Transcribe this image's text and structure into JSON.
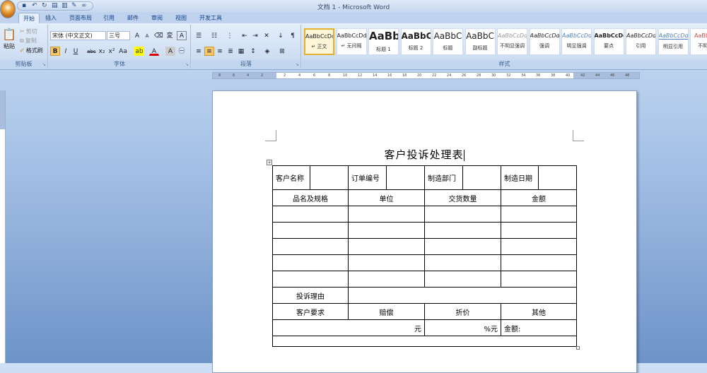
{
  "window": {
    "title": "文档 1 - Microsoft Word"
  },
  "tabs": [
    "开始",
    "插入",
    "页面布局",
    "引用",
    "邮件",
    "审阅",
    "视图",
    "开发工具"
  ],
  "clipboard": {
    "paste": "粘贴",
    "cut": "剪切",
    "copy": "复制",
    "format_painter": "格式刷",
    "label": "剪贴板"
  },
  "font": {
    "name": "宋体 (中文正文)",
    "size": "三号",
    "label": "字体",
    "bold": "B",
    "italic": "I",
    "underline": "U",
    "strike": "abc",
    "sub": "x₂",
    "sup": "x²",
    "case": "Aa",
    "grow": "A",
    "shrink": "A",
    "color": "A",
    "charshade": "A",
    "enclose": "㊀"
  },
  "paragraph": {
    "label": "段落"
  },
  "styles": {
    "label": "样式",
    "items": [
      {
        "sample": "AaBbCcDd",
        "name": "↵ 正文"
      },
      {
        "sample": "AaBbCcDd",
        "name": "↵ 无间隔"
      },
      {
        "sample": "AaBb",
        "name": "标题 1"
      },
      {
        "sample": "AaBbC",
        "name": "标题 2"
      },
      {
        "sample": "AaBbC",
        "name": "标题"
      },
      {
        "sample": "AaBbC",
        "name": "副标题"
      },
      {
        "sample": "AaBbCcDd",
        "name": "不明显强调"
      },
      {
        "sample": "AaBbCcDd",
        "name": "强调"
      },
      {
        "sample": "AaBbCcDd",
        "name": "明显强调"
      },
      {
        "sample": "AaBbCcDd",
        "name": "要点"
      },
      {
        "sample": "AaBbCcDd",
        "name": "引用"
      },
      {
        "sample": "AaBbCcDd",
        "name": "明显引用"
      },
      {
        "sample": "AaBbCc",
        "name": "不明显"
      }
    ]
  },
  "ruler": [
    "8",
    "6",
    "4",
    "2",
    "2",
    "4",
    "6",
    "8",
    "10",
    "12",
    "14",
    "16",
    "18",
    "20",
    "22",
    "24",
    "26",
    "28",
    "30",
    "32",
    "34",
    "36",
    "38",
    "40",
    "42",
    "44",
    "46",
    "48"
  ],
  "document": {
    "title": "客户投诉处理表",
    "row1": [
      "客户名称",
      "",
      "订单编号",
      "",
      "制造部门",
      "",
      "制造日期",
      ""
    ],
    "headers": [
      "品名及规格",
      "单位",
      "交货数量",
      "金额"
    ],
    "reason": "投诉理由",
    "req": [
      "客户要求",
      "赔偿",
      "折价",
      "其他"
    ],
    "money": [
      "元",
      "%元",
      "金额:"
    ]
  }
}
